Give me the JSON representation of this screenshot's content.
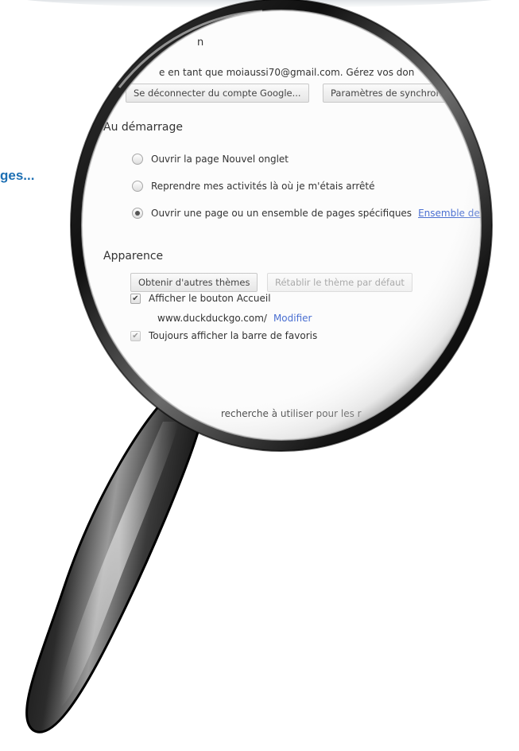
{
  "side_text": "ges...",
  "sync": {
    "heading_fragment": "n",
    "connected_text": "e en tant que moiaussi70@gmail.com. Gérez vos don",
    "disconnect_button": "Se déconnecter du compte Google...",
    "sync_settings_button": "Paramètres de synchron"
  },
  "startup": {
    "title": "Au démarrage",
    "options": [
      {
        "label": "Ouvrir la page Nouvel onglet",
        "checked": false
      },
      {
        "label": "Reprendre mes activités là où je m'étais arrêté",
        "checked": false
      },
      {
        "label": "Ouvrir une page ou un ensemble de pages spécifiques",
        "checked": true
      }
    ],
    "pages_link": "Ensemble de pages"
  },
  "appearance": {
    "title": "Apparence",
    "themes_button": "Obtenir d'autres thèmes",
    "reset_theme_button": "Rétablir le thème par défaut",
    "show_home_label": "Afficher le bouton Accueil",
    "home_url": "www.duckduckgo.com/",
    "modify_link": "Modifier",
    "bookmarks_bar_label": "Toujours afficher la barre de favoris"
  },
  "search": {
    "fragment": "recherche à utiliser pour les r"
  }
}
